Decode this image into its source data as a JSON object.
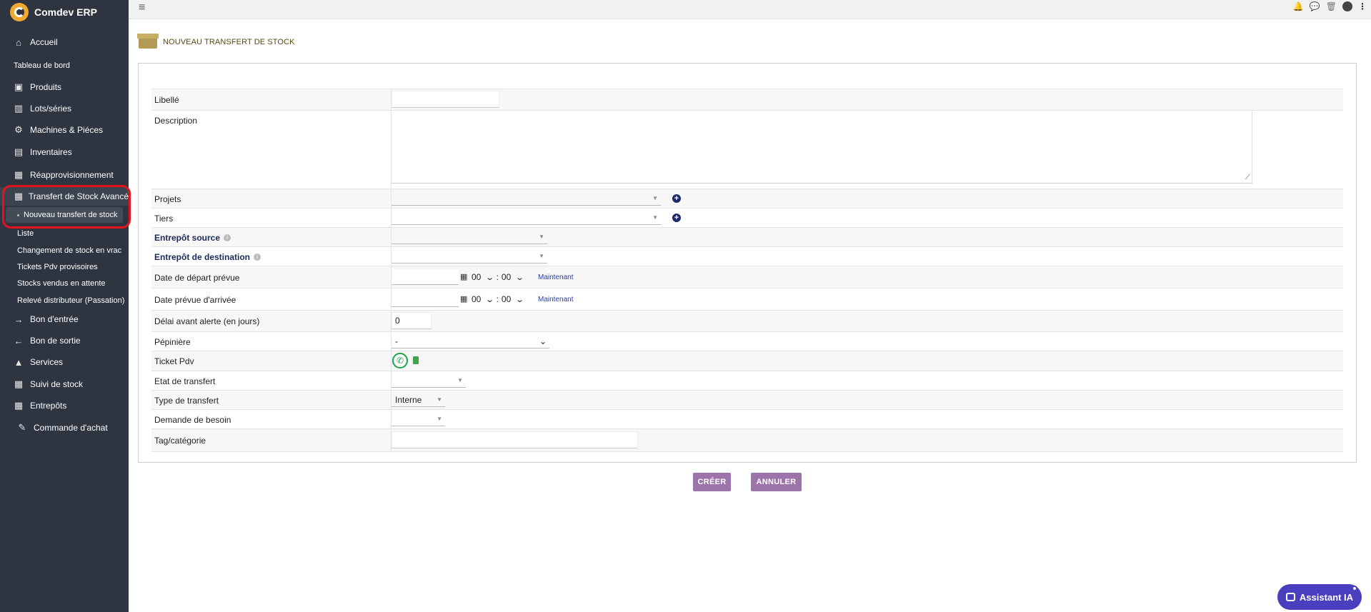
{
  "app": {
    "name": "Comdev ERP"
  },
  "sidebar": {
    "items": [
      {
        "label": "Accueil",
        "icon": "home-icon"
      },
      {
        "label": "Tableau de bord"
      },
      {
        "label": "Produits",
        "icon": "cube-icon"
      },
      {
        "label": "Lots/séries",
        "icon": "barcode-icon"
      },
      {
        "label": "Machines & Piéces",
        "icon": "cogs-icon"
      },
      {
        "label": "Inventaires",
        "icon": "boxes-icon"
      },
      {
        "label": "Réapprovisionnement",
        "icon": "box-open-icon"
      },
      {
        "label": "Transfert de Stock Avancé",
        "icon": "box-open-icon"
      },
      {
        "label": "Nouveau transfert de stock"
      },
      {
        "label": "Liste"
      },
      {
        "label": "Changement de stock en vrac"
      },
      {
        "label": "Tickets Pdv provisoires"
      },
      {
        "label": "Stocks vendus en attente"
      },
      {
        "label": "Relevé distributeur (Passation)"
      },
      {
        "label": "Bon d'entrée",
        "icon": "arrow-right-icon"
      },
      {
        "label": "Bon de sortie",
        "icon": "arrow-left-icon"
      },
      {
        "label": "Services",
        "icon": "bell-icon"
      },
      {
        "label": "Suivi de stock",
        "icon": "box-open-icon"
      },
      {
        "label": "Entrepôts",
        "icon": "box-open-icon"
      },
      {
        "label": "Commande d'achat",
        "icon": "dolly-icon"
      }
    ]
  },
  "page": {
    "title": "NOUVEAU TRANSFERT DE STOCK"
  },
  "form": {
    "libelle": {
      "label": "Libellé",
      "value": ""
    },
    "description": {
      "label": "Description",
      "value": ""
    },
    "projets": {
      "label": "Projets",
      "value": ""
    },
    "tiers": {
      "label": "Tiers",
      "value": ""
    },
    "entrepot_source": {
      "label": "Entrepôt source",
      "value": ""
    },
    "entrepot_destination": {
      "label": "Entrepôt de destination",
      "value": ""
    },
    "date_depart": {
      "label": "Date de départ prévue",
      "hour": "00",
      "minute": "00",
      "now_label": "Maintenant"
    },
    "date_arrivee": {
      "label": "Date prévue d'arrivée",
      "hour": "00",
      "minute": "00",
      "now_label": "Maintenant"
    },
    "delai": {
      "label": "Délai avant alerte (en jours)",
      "value": "0"
    },
    "pepiniere": {
      "label": "Pépinière",
      "value": "-"
    },
    "ticket_pdv": {
      "label": "Ticket Pdv"
    },
    "etat_transfert": {
      "label": "Etat de transfert",
      "value": ""
    },
    "type_transfert": {
      "label": "Type de transfert",
      "value": "Interne"
    },
    "demande_besoin": {
      "label": "Demande de besoin",
      "value": ""
    },
    "tag": {
      "label": "Tag/catégorie",
      "value": ""
    }
  },
  "actions": {
    "create": "CRÉER",
    "cancel": "ANNULER"
  },
  "assistant": {
    "label": "Assistant IA"
  },
  "colors": {
    "sidebar_bg": "#2e3540",
    "button": "#9c74aa",
    "assistant": "#4a3fbf",
    "highlight": "#e4141e"
  }
}
